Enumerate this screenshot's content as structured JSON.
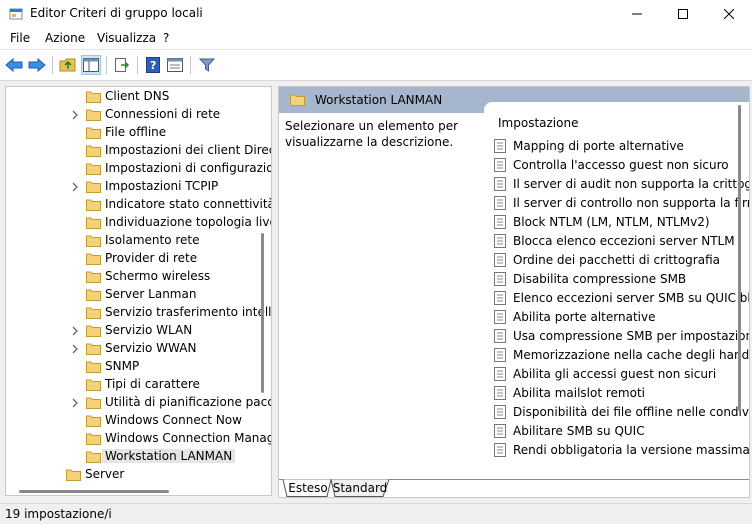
{
  "window": {
    "title": "Editor Criteri di gruppo locali"
  },
  "menu": {
    "items": [
      "File",
      "Azione",
      "Visualizza",
      "?"
    ]
  },
  "tree": {
    "items": [
      {
        "label": "Client DNS",
        "chevron": false
      },
      {
        "label": "Connessioni di rete",
        "chevron": true
      },
      {
        "label": "File offline",
        "chevron": false
      },
      {
        "label": "Impostazioni dei client Direc",
        "chevron": false
      },
      {
        "label": "Impostazioni di configurazio",
        "chevron": false
      },
      {
        "label": "Impostazioni TCPIP",
        "chevron": true
      },
      {
        "label": "Indicatore stato connettività",
        "chevron": false
      },
      {
        "label": "Individuazione topologia live",
        "chevron": false
      },
      {
        "label": "Isolamento rete",
        "chevron": false
      },
      {
        "label": "Provider di rete",
        "chevron": false
      },
      {
        "label": "Schermo wireless",
        "chevron": false
      },
      {
        "label": "Server Lanman",
        "chevron": false
      },
      {
        "label": "Servizio trasferimento intellig",
        "chevron": false
      },
      {
        "label": "Servizio WLAN",
        "chevron": true
      },
      {
        "label": "Servizio WWAN",
        "chevron": true
      },
      {
        "label": "SNMP",
        "chevron": false
      },
      {
        "label": "Tipi di carattere",
        "chevron": false
      },
      {
        "label": "Utilità di pianificazione pacc",
        "chevron": true
      },
      {
        "label": "Windows Connect Now",
        "chevron": false
      },
      {
        "label": "Windows Connection Manag",
        "chevron": false
      },
      {
        "label": "Workstation LANMAN",
        "chevron": false,
        "selected": true
      }
    ],
    "parent_sibling": "Server"
  },
  "right": {
    "header": "Workstation LANMAN",
    "description": "Selezionare un elemento per visualizzarne la descrizione.",
    "column_header": "Impostazione",
    "settings": [
      "Mapping di porte alternative",
      "Controlla l'accesso guest non sicuro",
      "Il server di audit non supporta la crittografia",
      "Il server di controllo non supporta la firma",
      "Block NTLM (LM, NTLM, NTLMv2)",
      "Blocca elenco eccezioni server NTLM",
      "Ordine dei pacchetti di crittografia",
      "Disabilita compressione SMB",
      "Elenco eccezioni server SMB su QUIC bla",
      "Abilita porte alternative",
      "Usa compressione SMB per impostazione",
      "Memorizzazione nella cache degli handle",
      "Abilita gli accessi guest non sicuri",
      "Abilita mailslot remoti",
      "Disponibilità dei file offline nelle condivis",
      "Abilitare SMB su QUIC",
      "Rendi obbligatoria la versione massima d"
    ],
    "tabs": [
      "Esteso",
      "Standard"
    ]
  },
  "status": {
    "text": "19 impostazione/i"
  }
}
